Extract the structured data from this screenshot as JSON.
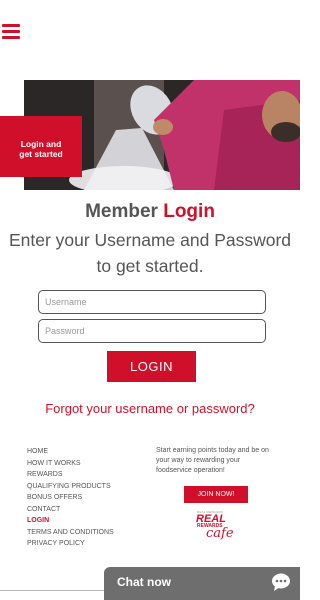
{
  "header": {
    "menu_icon": "hamburger-menu-icon"
  },
  "hero": {
    "badge_line1": "Login and",
    "badge_line2": "get started"
  },
  "title": {
    "part1": "Member ",
    "accent": "Login"
  },
  "subtitle": "Enter your Username and Password to get started.",
  "form": {
    "username_placeholder": "Username",
    "username_value": "",
    "password_placeholder": "Password",
    "password_value": "",
    "login_label": "LOGIN",
    "forgot_label": "Forgot your username or password?"
  },
  "footer": {
    "nav": [
      {
        "label": "HOME",
        "active": false
      },
      {
        "label": "HOW IT WORKS",
        "active": false
      },
      {
        "label": "REWARDS",
        "active": false
      },
      {
        "label": "QUALIFYING PRODUCTS",
        "active": false
      },
      {
        "label": "BONUS OFFERS",
        "active": false
      },
      {
        "label": "CONTACT",
        "active": false
      },
      {
        "label": "LOGIN",
        "active": true
      },
      {
        "label": "TERMS AND CONDITIONS",
        "active": false
      },
      {
        "label": "PRIVACY POLICY",
        "active": false
      }
    ],
    "promo_text": "Start earning points today and be on your way to rewarding your foodservice operation!",
    "join_label": "JOIN NOW!",
    "logo": {
      "tagline": "REAL REWARDS",
      "real": "REAL",
      "rewards": "REWARDS",
      "cafe": "cafe"
    }
  },
  "chat": {
    "label": "Chat now",
    "icon": "chat-bubble-icon"
  },
  "colors": {
    "brand_red": "#d0102b",
    "text_gray": "#555555",
    "chat_gray": "#6e6e6e"
  }
}
